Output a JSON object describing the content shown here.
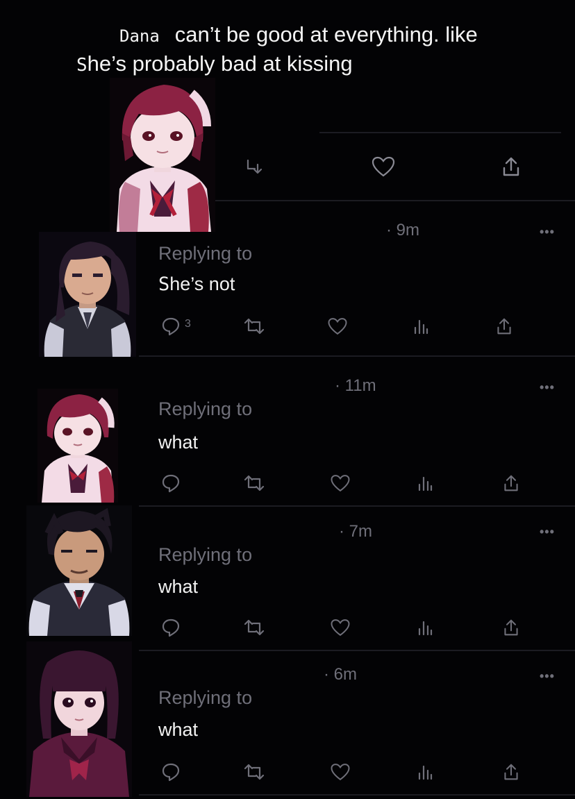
{
  "header": {
    "name": "Dana",
    "line1_rest": "can’t be good at everything. like",
    "line2_initial": "S",
    "line2_rest": "he’s probably bad at kissing"
  },
  "colors": {
    "background": "#030305",
    "text": "#f2f2f2",
    "muted": "#6f6f79",
    "divider": "#1c1c22"
  },
  "icons": {
    "reply": "reply-icon",
    "retweet": "retweet-icon",
    "like": "heart-icon",
    "views": "views-icon",
    "share": "share-icon"
  },
  "tweets": [
    {
      "time": "· 9m",
      "more": "•••",
      "replying": "Replying to",
      "body_initial": "S",
      "body_rest": "he’s not",
      "reply_count": "3"
    },
    {
      "time": "· 11m",
      "more": "•••",
      "replying": "Replying to",
      "body": "what"
    },
    {
      "time": "· 7m",
      "more": "•••",
      "replying": "Replying to",
      "body": "what"
    },
    {
      "time": "· 6m",
      "more": "•••",
      "replying": "Replying to",
      "body": "what"
    }
  ]
}
